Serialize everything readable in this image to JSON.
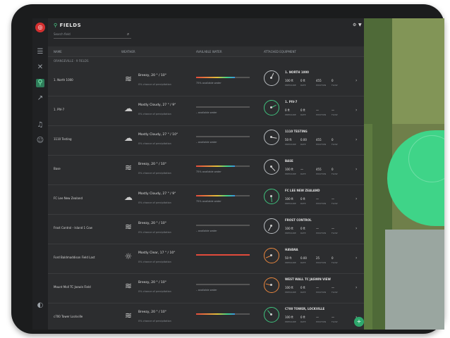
{
  "app": {
    "title": "FIELDS",
    "search_placeholder": "Search field"
  },
  "header_icons": [
    "settings-icon",
    "filter-icon"
  ],
  "columns": [
    "NAME",
    "WEATHER",
    "AVAILABLE WATER",
    "ATTACHED EQUIPMENT"
  ],
  "group_label": "ORANGEVILLE · 9 FIELDS",
  "rows": [
    {
      "name": "1. North 1000",
      "weather_icon": "wind",
      "weather": "Breezy, 20 ° / 10°",
      "precip": "0% chance of precipitation",
      "water": "75% available water",
      "water_pct": 0.72,
      "water_multicolor": true,
      "equip_color": "gray",
      "equip_title": "1. NORTH 1000",
      "stats": [
        "100 ft",
        "0 ft",
        "455",
        "0"
      ],
      "stat_labels": [
        "PRESSURE",
        "RATE",
        "POSITION",
        "FLOW"
      ]
    },
    {
      "name": "1. PIV-7",
      "weather_icon": "cloud",
      "weather": "Mostly Cloudy, 27 ° / 9°",
      "precip": "0% chance of precipitation",
      "water": "– available water",
      "water_pct": 0.0,
      "water_multicolor": false,
      "equip_color": "green",
      "equip_title": "1. PIV-7",
      "stats": [
        "0 ft",
        "0 ft",
        "—",
        "—"
      ],
      "stat_labels": [
        "PRESSURE",
        "RATE",
        "POSITION",
        "FLOW"
      ]
    },
    {
      "name": "1110 Testing",
      "weather_icon": "cloud",
      "weather": "Mostly Cloudy, 27 ° / 10°",
      "precip": "0% chance of precipitation",
      "water": "– available water",
      "water_pct": 0.0,
      "water_multicolor": false,
      "equip_color": "gray",
      "equip_title": "1110 TESTING",
      "stats": [
        "50 ft",
        "0.00",
        "455",
        "0"
      ],
      "stat_labels": [
        "PRESSURE",
        "RATE",
        "POSITION",
        "FLOW"
      ]
    },
    {
      "name": "Base",
      "weather_icon": "wind",
      "weather": "Breezy, 20 ° / 10°",
      "precip": "0% chance of precipitation",
      "water": "75% available water",
      "water_pct": 0.72,
      "water_multicolor": true,
      "equip_color": "gray",
      "equip_title": "BASE",
      "stats": [
        "100 ft",
        "—",
        "455",
        "0"
      ],
      "stat_labels": [
        "PRESSURE",
        "RATE",
        "POSITION",
        "FLOW"
      ]
    },
    {
      "name": "FC Lee New Zealand",
      "weather_icon": "cloud",
      "weather": "Mostly Cloudy, 27 ° / 9°",
      "precip": "0% chance of precipitation",
      "water": "75% available water",
      "water_pct": 0.72,
      "water_multicolor": true,
      "equip_color": "green",
      "equip_title": "FC LEE NEW ZEALAND",
      "stats": [
        "100 ft",
        "0 ft",
        "—",
        "—"
      ],
      "stat_labels": [
        "PRESSURE",
        "RATE",
        "POSITION",
        "FLOW"
      ]
    },
    {
      "name": "Frost Control - Island 1 Cow",
      "weather_icon": "wind",
      "weather": "Breezy, 20 ° / 10°",
      "precip": "0% chance of precipitation",
      "water": "– available water",
      "water_pct": 0.0,
      "water_multicolor": false,
      "equip_color": "gray",
      "equip_title": "FROST CONTROL",
      "stats": [
        "100 ft",
        "0 ft",
        "—",
        "—"
      ],
      "stat_labels": [
        "PRESSURE",
        "RATE",
        "POSITION",
        "FLOW"
      ]
    },
    {
      "name": "Ford Baldmaddison Field Last",
      "weather_icon": "sun",
      "weather": "Mostly Clear, 17 ° / 10°",
      "precip": "0% chance of precipitation",
      "water": "",
      "water_pct": 1.0,
      "water_multicolor": false,
      "equip_color": "orange",
      "equip_title": "HAVANA",
      "stats": [
        "50 ft",
        "0.00",
        "25",
        "0"
      ],
      "stat_labels": [
        "PRESSURE",
        "RATE",
        "POSITION",
        "FLOW"
      ]
    },
    {
      "name": "Mount Moll TC Jaswin Field",
      "weather_icon": "wind",
      "weather": "Breezy, 20 ° / 10°",
      "precip": "0% chance of precipitation",
      "water": "– available water",
      "water_pct": 0.0,
      "water_multicolor": false,
      "equip_color": "orange",
      "equip_title": "WEST WALL TC JASWIN VIEW",
      "stats": [
        "100 ft",
        "0 ft",
        "—",
        "—"
      ],
      "stat_labels": [
        "PRESSURE",
        "RATE",
        "POSITION",
        "FLOW"
      ]
    },
    {
      "name": "c700 Tower Lockville",
      "weather_icon": "wind",
      "weather": "Breezy, 20 ° / 10°",
      "precip": "0% chance of precipitation",
      "water": "",
      "water_pct": 0.72,
      "water_multicolor": true,
      "equip_color": "green",
      "equip_title": "C700 TOWER, LOCKVILLE",
      "stats": [
        "100 ft",
        "0 ft",
        "—",
        "—"
      ],
      "stat_labels": [
        "PRESSURE",
        "RATE",
        "POSITION",
        "FLOW"
      ]
    }
  ],
  "rail_icons": [
    "menu-icon",
    "map-icon",
    "fields-icon",
    "chart-icon",
    "bell-icon",
    "user-icon",
    "logout-icon"
  ],
  "colors": {
    "accent": "#3fd488",
    "alert": "#e24a3b",
    "warning": "#e8863e",
    "panel": "#2c2d2f"
  }
}
